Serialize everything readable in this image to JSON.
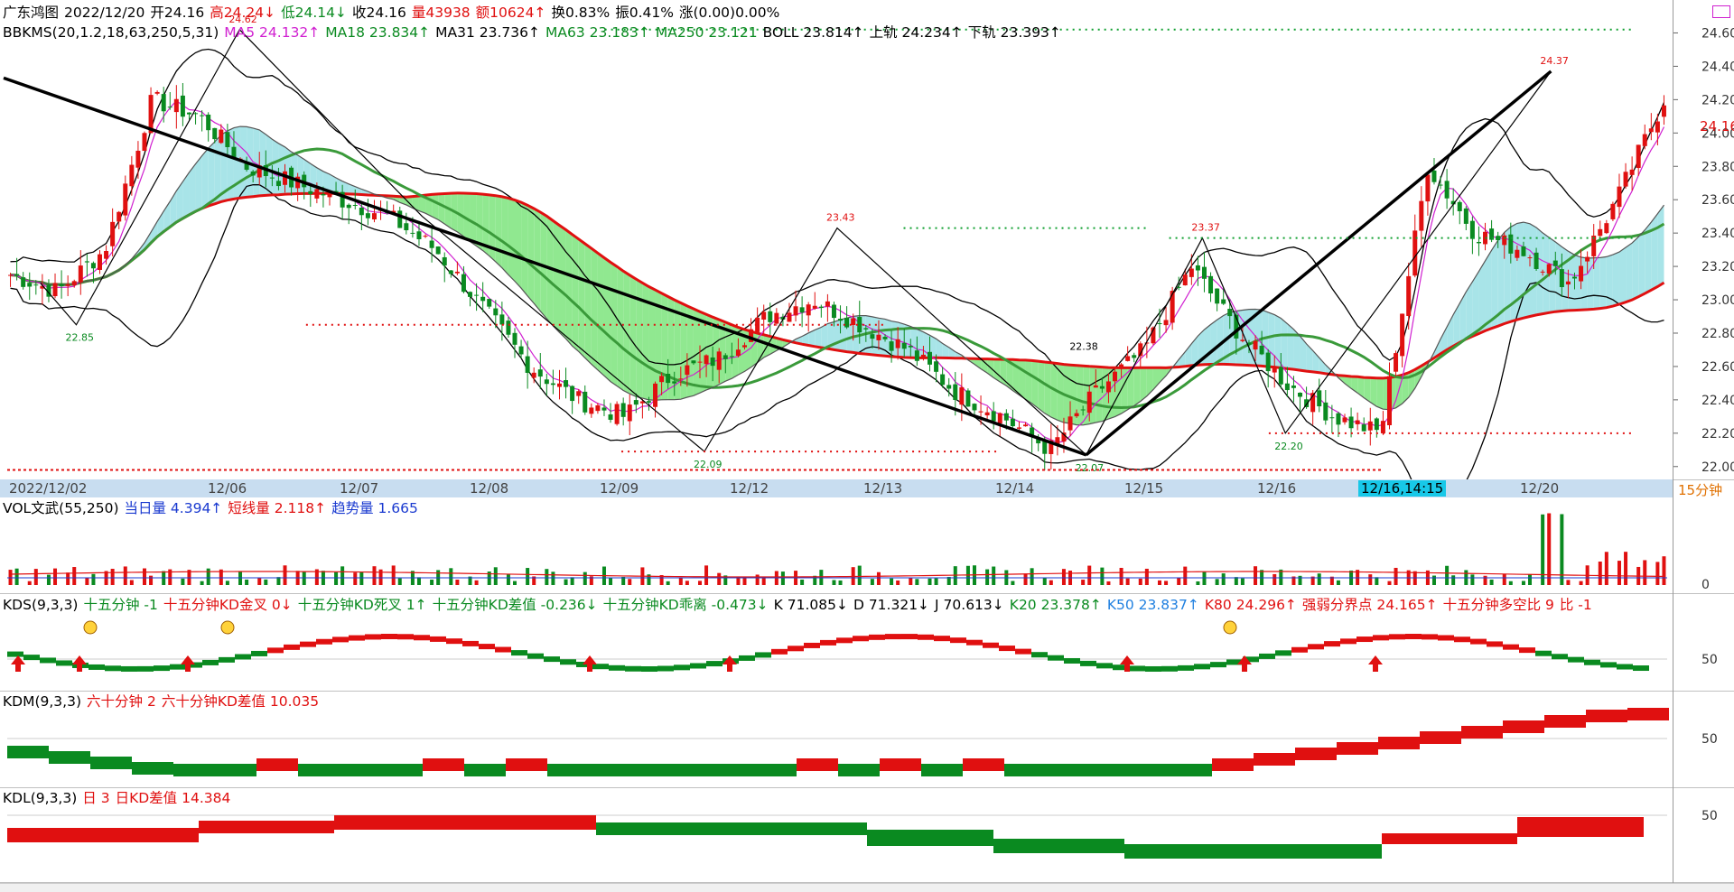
{
  "header": {
    "stock": "广东鸿图",
    "date": "2022/12/20",
    "open": "开24.16",
    "high": "高24.24",
    "high_arrow": "↓",
    "low": "低24.14",
    "low_arrow": "↓",
    "close": "收24.16",
    "vol": "量43938",
    "vol_arrow": "↑",
    "amount": "额10624",
    "amount_arrow": "↑",
    "turnover": "换0.83%",
    "amplitude": "振0.41%",
    "change": "涨(0.00)0.00%"
  },
  "main_indicator": {
    "name": "BBKMS(20,1.2,18,63,250,5,31)",
    "ma5": "MA5 24.132↑",
    "ma18": "MA18 23.834↑",
    "ma31": "MA31 23.736↑",
    "ma63": "MA63 23.183↑",
    "ma250": "MA250 23.121",
    "boll": "BOLL 23.814↑",
    "upper": "上轨 24.234↑",
    "lower": "下轨 23.393↑"
  },
  "vol_panel": {
    "name": "VOL文武(55,250)",
    "day": "当日量 4.394↑",
    "short": "短线量 2.118↑",
    "trend": "趋势量 1.665",
    "zero": "0"
  },
  "kds_panel": {
    "name": "KDS(9,3,3)",
    "t1": "十五分钟 -1",
    "t2": "十五分钟KD金叉 0↓",
    "t3": "十五分钟KD死叉 1↑",
    "t4": "十五分钟KD差值 -0.236↓",
    "t5": "十五分钟KD乖离 -0.473↓",
    "k": "K 71.085↓",
    "d": "D 71.321↓",
    "j": "J 70.613↓",
    "k20": "K20 23.378↑",
    "k50": "K50 23.837↑",
    "k80": "K80 24.296↑",
    "strong": "强弱分界点 24.165↑",
    "ratio": "十五分钟多空比 9",
    "bi": "比 -1",
    "tick": "50"
  },
  "kdm_panel": {
    "name": "KDM(9,3,3)",
    "t1": "六十分钟 2",
    "t2": "六十分钟KD差值 10.035",
    "tick": "50"
  },
  "kdl_panel": {
    "name": "KDL(9,3,3)",
    "t1": "日 3",
    "t2": "日KD差值 14.384",
    "tick": "50"
  },
  "timebar": {
    "labels": [
      "2022/12/02",
      "12/06",
      "12/07",
      "12/08",
      "12/09",
      "12/12",
      "12/13",
      "12/14",
      "12/15",
      "12/16",
      "12/20"
    ],
    "selected": "12/16,14:15",
    "period": "15分钟"
  },
  "last_price": "24.16",
  "colors": {
    "up": "#e01010",
    "down": "#0a8a20",
    "cloud_green": "#90e890",
    "cloud_cyan": "#a8e4e8"
  },
  "chart_data": {
    "type": "candlestick",
    "price_axis_ticks": [
      "24.60",
      "24.40",
      "24.20",
      "24.00",
      "23.80",
      "23.60",
      "23.40",
      "23.20",
      "23.00",
      "22.80",
      "22.60",
      "22.40",
      "22.20",
      "22.00"
    ],
    "ylim": [
      21.95,
      24.7
    ],
    "peak_labels": [
      "24.62",
      "22.85",
      "23.43",
      "22.09",
      "22.38",
      "22.07",
      "23.37",
      "22.20",
      "24.37"
    ],
    "close_anchors": [
      23.15,
      23.05,
      23.3,
      24.2,
      24.1,
      23.8,
      23.7,
      23.6,
      23.5,
      23.3,
      22.95,
      22.6,
      22.4,
      22.3,
      22.55,
      22.65,
      22.9,
      23.0,
      22.85,
      22.7,
      22.45,
      22.3,
      22.1,
      22.45,
      22.7,
      23.2,
      22.8,
      22.5,
      22.3,
      22.2,
      23.8,
      23.4,
      23.3,
      23.1,
      23.6,
      24.2
    ]
  }
}
